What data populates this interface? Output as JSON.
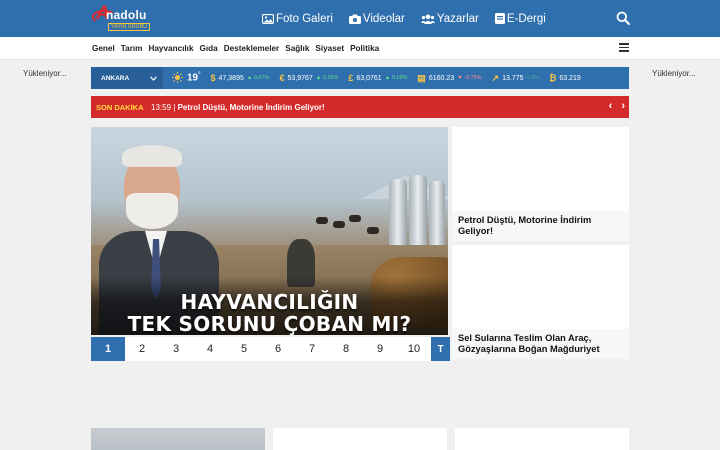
{
  "header": {
    "logo": {
      "mark": "A",
      "word": "nadolu",
      "sub": "YAYIN GRUBU"
    },
    "nav": [
      {
        "label": "Foto Galeri",
        "icon": "image-icon"
      },
      {
        "label": "Videolar",
        "icon": "camera-icon"
      },
      {
        "label": "Yazarlar",
        "icon": "users-icon"
      },
      {
        "label": "E-Dergi",
        "icon": "book-icon"
      }
    ]
  },
  "categories": [
    "Genel",
    "Tarım",
    "Hayvancılık",
    "Gıda",
    "Desteklemeler",
    "Sağlık",
    "Siyaset",
    "Politika"
  ],
  "side_loading": {
    "left": "Yükleniyor...",
    "right": "Yükleniyor..."
  },
  "ticker": {
    "city": "ANKARA",
    "temperature": "19",
    "degree": "°",
    "markets": [
      {
        "symbol": "$",
        "value": "47,3895",
        "change": "0.07%",
        "dir": "up"
      },
      {
        "symbol": "€",
        "value": "53,9767",
        "change": "0.15%",
        "dir": "up"
      },
      {
        "symbol": "£",
        "value": "63,0761",
        "change": "0.16%",
        "dir": "up"
      },
      {
        "symbol": "▤",
        "value": "6160.23",
        "change": "-0.75%",
        "dir": "down"
      },
      {
        "symbol": "↗",
        "value": "13.775",
        "change": "0.8%",
        "dir": "up"
      },
      {
        "symbol": "₿",
        "value": "63.219",
        "change": "",
        "dir": "up"
      }
    ]
  },
  "breaking": {
    "label": "SON DAKİKA",
    "time": "13:59",
    "separator": "|",
    "headline": "Petrol Düştü, Motorine İndirim Geliyor!"
  },
  "hero": {
    "title_line1": "HAYVANCILIĞIN",
    "title_line2": "TEK SORUNU ÇOBAN MI?",
    "pages": [
      "1",
      "2",
      "3",
      "4",
      "5",
      "6",
      "7",
      "8",
      "9",
      "10"
    ],
    "active_page": "1",
    "last_button": "T"
  },
  "side_news": [
    {
      "title": "Petrol Düştü, Motorine İndirim Geliyor!"
    },
    {
      "title": "Sel Sularına Teslim Olan Araç, Gözyaşlarına Boğan Mağduriyet"
    }
  ],
  "colors": {
    "brand": "#2f6fad",
    "breaking": "#d42a2a",
    "accent": "#f6c343"
  }
}
